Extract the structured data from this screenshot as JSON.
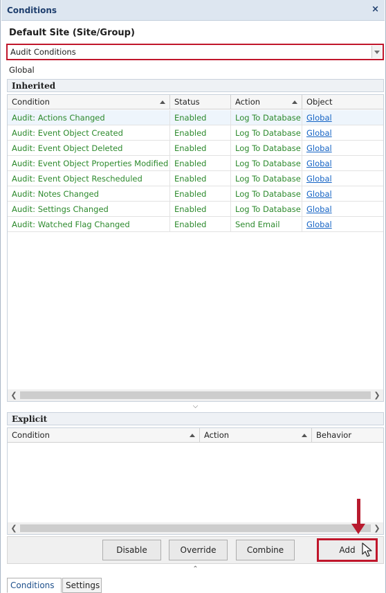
{
  "panel": {
    "title": "Conditions",
    "close_glyph": "×",
    "site_label": "Default Site (Site/Group)",
    "combo_value": "Audit Conditions",
    "scope_label": "Global"
  },
  "inherited": {
    "title": "Inherited",
    "columns": [
      "Condition",
      "Status",
      "Action",
      "Object"
    ],
    "rows": [
      {
        "condition": "Audit: Actions Changed",
        "status": "Enabled",
        "action": "Log To Database",
        "object": "Global"
      },
      {
        "condition": "Audit: Event Object Created",
        "status": "Enabled",
        "action": "Log To Database",
        "object": "Global"
      },
      {
        "condition": "Audit: Event Object Deleted",
        "status": "Enabled",
        "action": "Log To Database",
        "object": "Global"
      },
      {
        "condition": "Audit: Event Object Properties Modified",
        "status": "Enabled",
        "action": "Log To Database",
        "object": "Global"
      },
      {
        "condition": "Audit: Event Object Rescheduled",
        "status": "Enabled",
        "action": "Log To Database",
        "object": "Global"
      },
      {
        "condition": "Audit: Notes Changed",
        "status": "Enabled",
        "action": "Log To Database",
        "object": "Global"
      },
      {
        "condition": "Audit: Settings Changed",
        "status": "Enabled",
        "action": "Log To Database",
        "object": "Global"
      },
      {
        "condition": "Audit: Watched Flag Changed",
        "status": "Enabled",
        "action": "Send Email",
        "object": "Global"
      }
    ]
  },
  "explicit": {
    "title": "Explicit",
    "columns": [
      "Condition",
      "Action",
      "Behavior"
    ]
  },
  "buttons": {
    "disable": "Disable",
    "override": "Override",
    "combine": "Combine",
    "add": "Add"
  },
  "tabs": [
    "Conditions",
    "Settings"
  ],
  "colors": {
    "highlight_red": "#c0162b",
    "condition_green": "#2d8a2d",
    "link_blue": "#1463c4"
  },
  "icons": {
    "close": "close-icon",
    "dropdown": "chevron-down-icon",
    "scroll_left": "chevron-left-icon",
    "scroll_right": "chevron-right-icon",
    "collapse_down": "chevron-down-icon",
    "collapse_up": "chevron-up-icon",
    "cursor": "mouse-pointer-icon",
    "annotation": "down-arrow-icon"
  }
}
